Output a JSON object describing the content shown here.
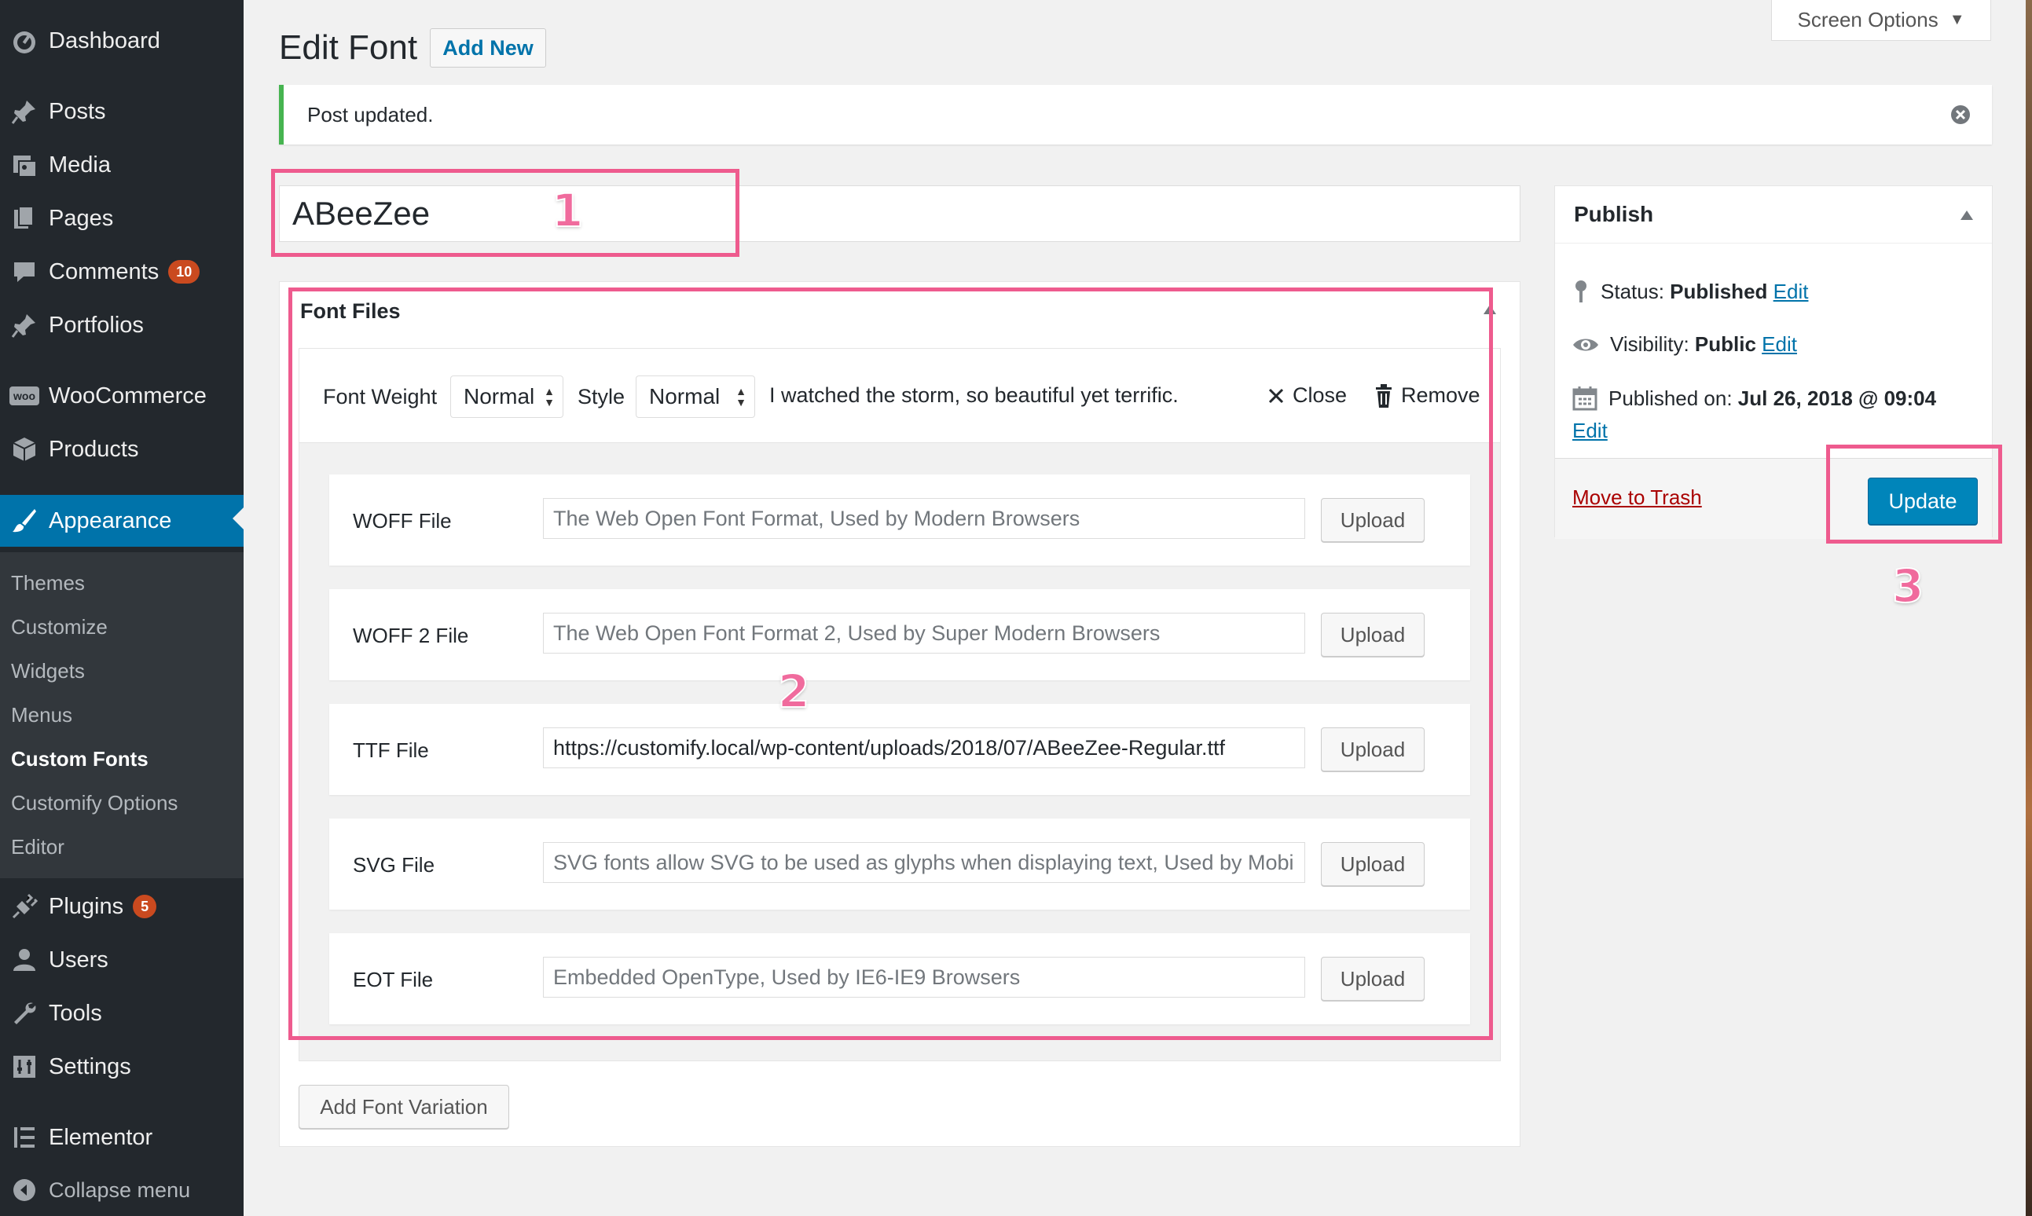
{
  "sidebar": {
    "dashboard": "Dashboard",
    "posts": "Posts",
    "media": "Media",
    "pages": "Pages",
    "comments": "Comments",
    "comments_count": "10",
    "portfolios": "Portfolios",
    "woocommerce": "WooCommerce",
    "products": "Products",
    "appearance": "Appearance",
    "submenu": {
      "themes": "Themes",
      "customize": "Customize",
      "widgets": "Widgets",
      "menus": "Menus",
      "custom_fonts": "Custom Fonts",
      "customify_options": "Customify Options",
      "editor": "Editor"
    },
    "plugins": "Plugins",
    "plugins_count": "5",
    "users": "Users",
    "tools": "Tools",
    "settings": "Settings",
    "elementor": "Elementor",
    "collapse": "Collapse menu",
    "woo_icon_text": "woo"
  },
  "header": {
    "title": "Edit Font",
    "add_new": "Add New",
    "screen_options": "Screen Options"
  },
  "notice": {
    "message": "Post updated."
  },
  "post_title": "ABeeZee",
  "font_files": {
    "title": "Font Files",
    "font_weight_label": "Font Weight",
    "font_weight_value": "Normal",
    "style_label": "Style",
    "style_value": "Normal",
    "preview_text": "I watched the storm, so beautiful yet terrific.",
    "close": "Close",
    "remove": "Remove",
    "rows": [
      {
        "label": "WOFF File",
        "value": "",
        "placeholder": "The Web Open Font Format, Used by Modern Browsers",
        "button": "Upload"
      },
      {
        "label": "WOFF 2 File",
        "value": "",
        "placeholder": "The Web Open Font Format 2, Used by Super Modern Browsers",
        "button": "Upload"
      },
      {
        "label": "TTF File",
        "value": "https://customify.local/wp-content/uploads/2018/07/ABeeZee-Regular.ttf",
        "placeholder": "",
        "button": "Upload"
      },
      {
        "label": "SVG File",
        "value": "",
        "placeholder": "SVG fonts allow SVG to be used as glyphs when displaying text, Used by Mobile Safari",
        "button": "Upload"
      },
      {
        "label": "EOT File",
        "value": "",
        "placeholder": "Embedded OpenType, Used by IE6-IE9 Browsers",
        "button": "Upload"
      }
    ],
    "add_variation": "Add Font Variation"
  },
  "publish": {
    "title": "Publish",
    "status_label": "Status:",
    "status_value": "Published",
    "visibility_label": "Visibility:",
    "visibility_value": "Public",
    "published_label": "Published on:",
    "published_value": "Jul 26, 2018 @ 09:04",
    "edit": "Edit",
    "trash": "Move to Trash",
    "update": "Update"
  },
  "annotations": {
    "one": "1",
    "two": "2",
    "three": "3"
  },
  "colors": {
    "sidebar": "#23282d",
    "accent": "#0073aa",
    "annotation": "#ee5b8e",
    "notice_border": "#46b450"
  }
}
